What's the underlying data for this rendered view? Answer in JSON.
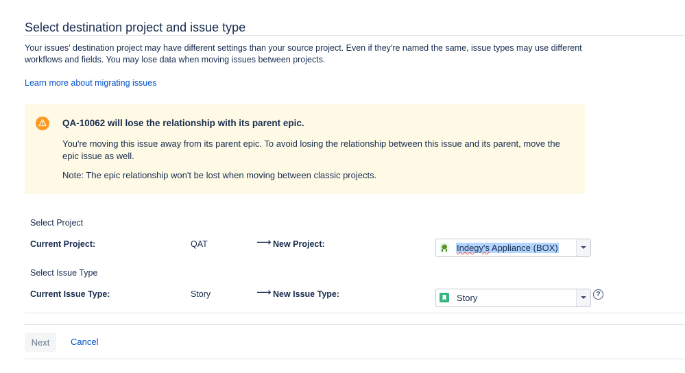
{
  "page": {
    "title": "Select destination project and issue type",
    "intro": "Your issues' destination project may have different settings than your source project. Even if they're named the same, issue types may use different workflows and fields. You may lose data when moving issues between projects.",
    "learn_more": "Learn more about migrating issues"
  },
  "warning": {
    "icon": "warning-icon",
    "accent_color": "#ff991f",
    "background": "#fffae6",
    "heading": "QA-10062 will lose the relationship with its parent epic.",
    "body": "You're moving this issue away from its parent epic. To avoid losing the relationship between this issue and its parent, move the epic issue as well.",
    "note": "Note: The epic relationship won't be lost when moving between classic projects."
  },
  "project": {
    "section_label": "Select Project",
    "current_label": "Current Project:",
    "current_value": "QAT",
    "arrow": "⟶",
    "new_label": "New Project:",
    "select": {
      "icon": "project-avatar-icon",
      "value_first": "Indegy's",
      "value_rest": " Appliance (BOX)"
    }
  },
  "issue_type": {
    "section_label": "Select Issue Type",
    "current_label": "Current Issue Type:",
    "current_value": "Story",
    "arrow": "⟶",
    "new_label": "New Issue Type:",
    "select": {
      "icon": "story-icon",
      "icon_color": "#36b37e",
      "value": "Story"
    },
    "help": "?"
  },
  "actions": {
    "next": "Next",
    "cancel": "Cancel"
  }
}
